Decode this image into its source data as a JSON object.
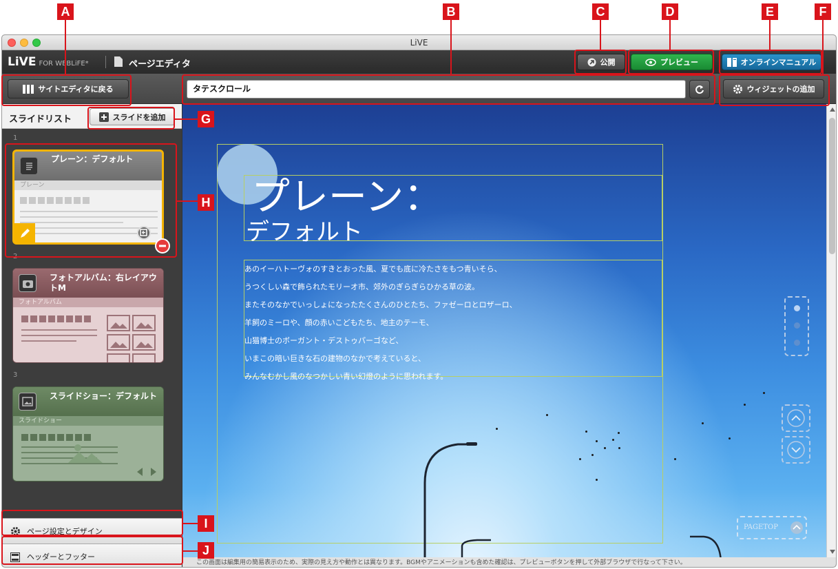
{
  "callouts": [
    "A",
    "B",
    "C",
    "D",
    "E",
    "F",
    "G",
    "H",
    "I",
    "J"
  ],
  "window": {
    "title": "LiVE"
  },
  "app": {
    "logo": "LiVE",
    "logo_sub": "FOR WEBLiFE*",
    "page_title": "ページエディタ"
  },
  "header_buttons": {
    "publish": "公開",
    "preview": "プレビュー",
    "manual": "オンラインマニュアル"
  },
  "toolbar": {
    "back": "サイトエディタに戻る",
    "page_name": "タテスクロール",
    "add_widget": "ウィジェットの追加"
  },
  "sidebar": {
    "title": "スライドリスト",
    "add_slide": "スライドを追加",
    "slides": [
      {
        "number": "1",
        "title": "プレーン：デフォルト",
        "subtitle": "プレーン",
        "color": "#808080"
      },
      {
        "number": "2",
        "title": "フォトアルバム：右レイアウトM",
        "subtitle": "フォトアルバム",
        "color": "#8a5a5f"
      },
      {
        "number": "3",
        "title": "スライドショー：デフォルト",
        "subtitle": "スライドショー",
        "color": "#5e7a55"
      }
    ],
    "page_settings": "ページ設定とデザイン",
    "header_footer": "ヘッダーとフッター"
  },
  "canvas": {
    "heading_line1": "プレーン：",
    "heading_line2": "デフォルト",
    "body_lines": [
      "あのイーハトーヴォのすきとおった風、夏でも底に冷たさをもつ青いそら、",
      "うつくしい森で飾られたモリーオ市、郊外のぎらぎらひかる草の波。",
      "またそのなかでいっしょになったたくさんのひとたち、ファゼーロとロザーロ、",
      "羊飼のミーロや、顔の赤いこどもたち、地主のテーモ、",
      "山猫博士のボーガント・デストゥパーゴなど、",
      "いまこの暗い巨きな石の建物のなかで考えていると、",
      "みんなむかし風のなつかしい青い幻燈のように思われます。"
    ],
    "pagetop": "PAGETOP"
  },
  "status": "この画面は編集用の簡易表示のため、実際の見え方や動作とは異なります。BGMやアニメーションも含めた確認は、プレビューボタンを押して外部ブラウザで行なって下さい。",
  "colors": {
    "callout": "#d9141b",
    "preview_green": "#1f9a3a",
    "manual_blue": "#1a7fb4",
    "selected_slide": "#f5b400"
  }
}
